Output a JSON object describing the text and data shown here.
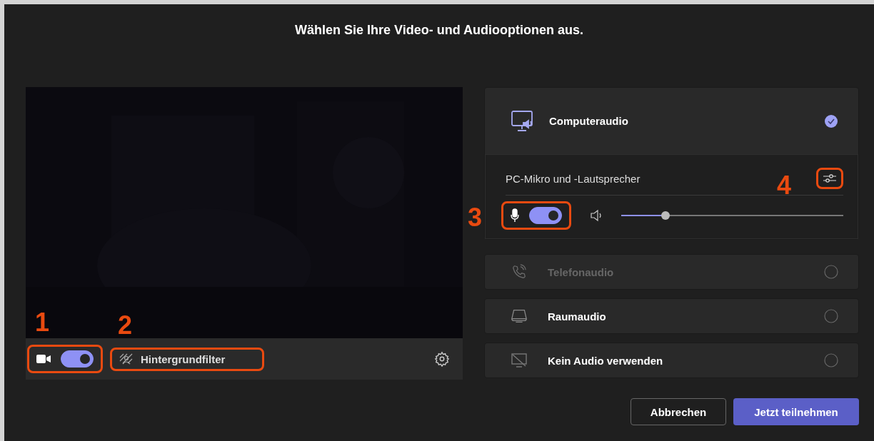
{
  "title": "Wählen Sie Ihre Video- und Audiooptionen aus.",
  "video": {
    "camera_on": true,
    "camera_callout": "1",
    "filter_label": "Hintergrundfilter",
    "filter_callout": "2"
  },
  "audio_options": [
    {
      "kind": "computer",
      "label": "Computeraudio",
      "selected": true,
      "disabled": false
    },
    {
      "kind": "phone",
      "label": "Telefonaudio",
      "selected": false,
      "disabled": true
    },
    {
      "kind": "room",
      "label": "Raumaudio",
      "selected": false,
      "disabled": false
    },
    {
      "kind": "none",
      "label": "Kein Audio verwenden",
      "selected": false,
      "disabled": false
    }
  ],
  "device": {
    "label": "PC-Mikro und -Lautsprecher",
    "settings_callout": "4",
    "mic_on": true,
    "mic_callout": "3",
    "volume": {
      "level": 0.2
    }
  },
  "buttons": [
    {
      "kind": "secondary",
      "label": "Abbrechen"
    },
    {
      "kind": "primary",
      "label": "Jetzt teilnehmen"
    }
  ]
}
